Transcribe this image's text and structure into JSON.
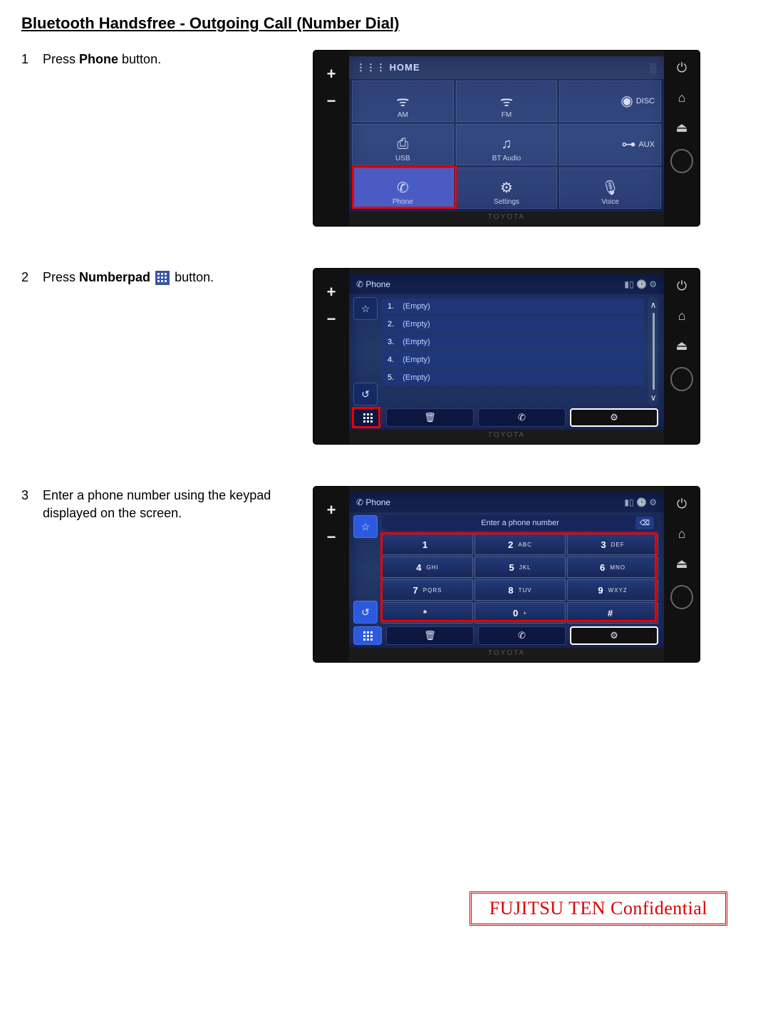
{
  "title": "Bluetooth Handsfree - Outgoing Call (Number Dial)",
  "steps": {
    "s1": {
      "num": "1",
      "pre": "Press ",
      "bold": "Phone",
      "post": " button."
    },
    "s2": {
      "num": "2",
      "pre": "Press ",
      "bold": "Numberpad",
      "post": " button."
    },
    "s3": {
      "num": "3",
      "text": "Enter a phone number using the keypad displayed on the screen."
    }
  },
  "unit": {
    "plus": "+",
    "minus": "−",
    "brand": "TOYOTA"
  },
  "screen1": {
    "top_label": "HOME",
    "items": {
      "am": "AM",
      "fm": "FM",
      "disc": "DISC",
      "usb": "USB",
      "btaudio": "BT Audio",
      "aux": "AUX",
      "phone": "Phone",
      "settings": "Settings",
      "voice": "Voice"
    }
  },
  "screen2": {
    "title": "Phone",
    "rows": [
      {
        "n": "1.",
        "v": "(Empty)"
      },
      {
        "n": "2.",
        "v": "(Empty)"
      },
      {
        "n": "3.",
        "v": "(Empty)"
      },
      {
        "n": "4.",
        "v": "(Empty)"
      },
      {
        "n": "5.",
        "v": "(Empty)"
      }
    ],
    "scroll_up": "∧",
    "scroll_down": "∨"
  },
  "screen3": {
    "title": "Phone",
    "prompt": "Enter a phone number",
    "del": "⌫",
    "keys": [
      {
        "n": "1",
        "s": ""
      },
      {
        "n": "2",
        "s": "ABC"
      },
      {
        "n": "3",
        "s": "DEF"
      },
      {
        "n": "4",
        "s": "GHI"
      },
      {
        "n": "5",
        "s": "JKL"
      },
      {
        "n": "6",
        "s": "MNO"
      },
      {
        "n": "7",
        "s": "PQRS"
      },
      {
        "n": "8",
        "s": "TUV"
      },
      {
        "n": "9",
        "s": "WXYZ"
      },
      {
        "n": "*",
        "s": ""
      },
      {
        "n": "0",
        "s": "+"
      },
      {
        "n": "#",
        "s": ""
      }
    ]
  },
  "stamp": "FUJITSU TEN Confidential"
}
